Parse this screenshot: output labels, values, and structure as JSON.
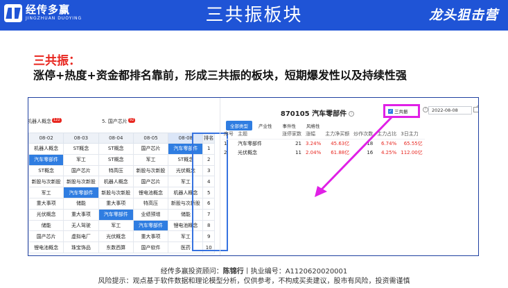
{
  "header": {
    "logo_cn": "经传多赢",
    "logo_en": "JINGZHUAN DUOYING",
    "title": "三共振板块",
    "brand": "龙头狙击营"
  },
  "intro": {
    "heading": "三共振：",
    "definition": "涨停+热度+资金都排名靠前，形成三共振的板块，短期爆发性以及持续性强"
  },
  "left_panel": {
    "tags": [
      {
        "label": "机器人概念",
        "badge": "122"
      },
      {
        "label": "5. 国产芯片",
        "badge": "92"
      }
    ],
    "columns": [
      "08-02",
      "08-03",
      "08-04",
      "08-05",
      "08-08"
    ],
    "rank_header": "排名",
    "rows": [
      {
        "cells": [
          "机器人概念",
          "ST概念",
          "ST概念",
          "国产芯片",
          "汽车零部件"
        ],
        "rank": "1"
      },
      {
        "cells": [
          "汽车零部件",
          "军工",
          "ST概念",
          "军工",
          "ST概念"
        ],
        "rank": "2"
      },
      {
        "cells": [
          "ST概念",
          "国产芯片",
          "特高压",
          "新股与次新股",
          "光伏概念"
        ],
        "rank": "3"
      },
      {
        "cells": [
          "新股与次新股",
          "新股与次新股",
          "机器人概念",
          "国产芯片",
          "军工"
        ],
        "rank": "4"
      },
      {
        "cells": [
          "军工",
          "汽车零部件",
          "新股与次新股",
          "锂电池概念",
          "机器人概念"
        ],
        "rank": "5"
      },
      {
        "cells": [
          "重大事项",
          "储能",
          "重大事项",
          "特高压",
          "新股与次新股"
        ],
        "rank": "6"
      },
      {
        "cells": [
          "光伏概念",
          "重大事项",
          "汽车零部件",
          "业绩预增",
          "储能"
        ],
        "rank": "7"
      },
      {
        "cells": [
          "储能",
          "无人驾驶",
          "军工",
          "汽车零部件",
          "锂电池概念"
        ],
        "rank": "8"
      },
      {
        "cells": [
          "国产芯片",
          "虚拟电厂",
          "光伏概念",
          "重大事项",
          "军工"
        ],
        "rank": "9"
      },
      {
        "cells": [
          "锂电池概念",
          "珠宝饰品",
          "东数西算",
          "国产软件",
          "医药"
        ],
        "rank": "10"
      }
    ]
  },
  "right_panel": {
    "title": "870105 汽车零部件",
    "info_icon": "info-icon",
    "tabs": [
      "全部类型",
      "产业性",
      "事件性",
      "风格性"
    ],
    "checkbox_label": "三共振",
    "checkbox_checked": true,
    "date_value": "2022-08-08",
    "table_headers": [
      "序号",
      "主题",
      "涨停家数",
      "涨幅",
      "主力净买额",
      "炒作次数",
      "主力占比",
      "3日主力"
    ],
    "table_rows": [
      [
        "1",
        "汽车零部件",
        "21",
        "3.24%",
        "45.63亿",
        "18",
        "6.74%",
        "65.55亿"
      ],
      [
        "2",
        "光伏概念",
        "11",
        "2.04%",
        "61.88亿",
        "16",
        "4.25%",
        "112.00亿"
      ]
    ]
  },
  "footer": {
    "line1_prefix": "经传多赢投资顾问：",
    "advisor": "陈锦行",
    "line1_suffix": "丨执业编号：A1120620020001",
    "line2": "风险提示：观点基于软件数据和理论模型分析，仅供参考，不构成买卖建议，股市有风险，投资需谨慎"
  },
  "colors": {
    "header_blue": "#1f54d6",
    "highlight_blue": "#2f7de1",
    "heading_red": "#e8261f",
    "annotation_magenta": "#e020e6"
  }
}
